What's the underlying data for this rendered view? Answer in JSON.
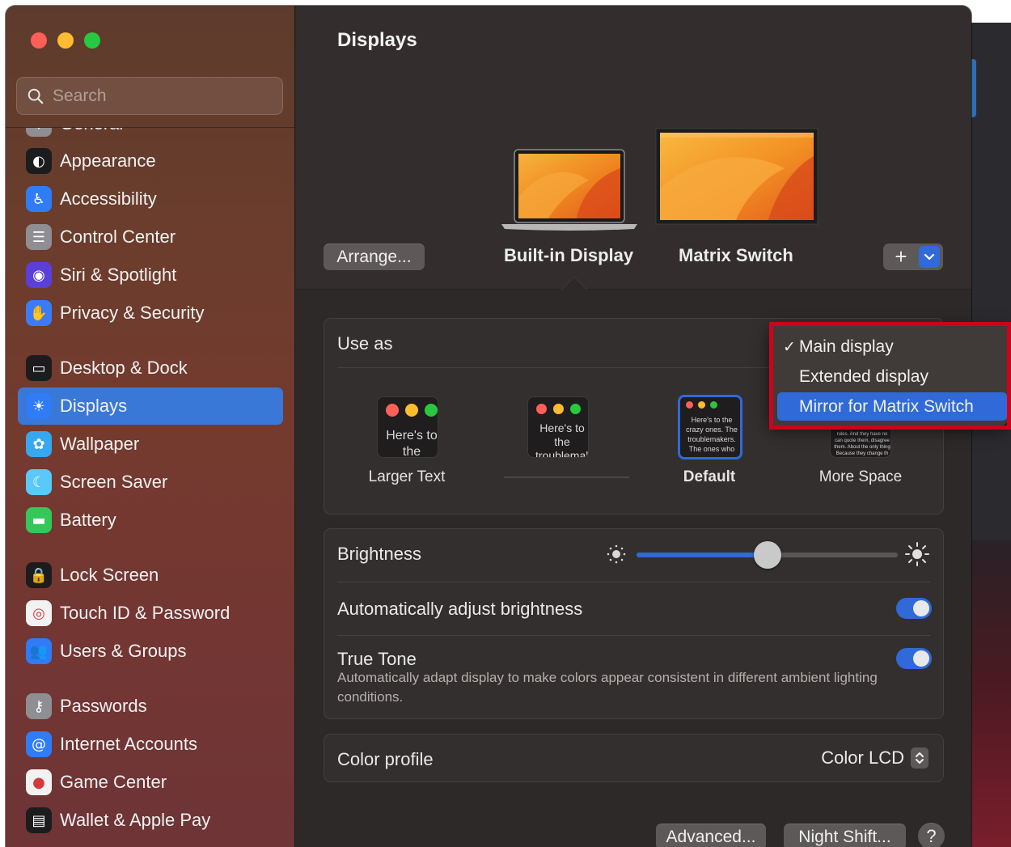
{
  "sidebar": {
    "search_placeholder": "Search",
    "items": [
      {
        "label": "General",
        "icon": "gear-icon",
        "color": "#8e8e93"
      },
      {
        "label": "Appearance",
        "icon": "appearance-icon",
        "color": "#1c1c1e"
      },
      {
        "label": "Accessibility",
        "icon": "accessibility-icon",
        "color": "#2f7cf6"
      },
      {
        "label": "Control Center",
        "icon": "control-center-icon",
        "color": "#8e8e93"
      },
      {
        "label": "Siri & Spotlight",
        "icon": "siri-icon",
        "color": "#5a3fd9"
      },
      {
        "label": "Privacy & Security",
        "icon": "hand-icon",
        "color": "#3a7cf6"
      },
      {
        "label": "Desktop & Dock",
        "icon": "dock-icon",
        "color": "#1c1c1e"
      },
      {
        "label": "Displays",
        "icon": "sun-icon",
        "color": "#2f7cf6"
      },
      {
        "label": "Wallpaper",
        "icon": "flower-icon",
        "color": "#37a7f0"
      },
      {
        "label": "Screen Saver",
        "icon": "screensaver-icon",
        "color": "#5ac8fa"
      },
      {
        "label": "Battery",
        "icon": "battery-icon",
        "color": "#34c759"
      },
      {
        "label": "Lock Screen",
        "icon": "lock-icon",
        "color": "#1c1c1e"
      },
      {
        "label": "Touch ID & Password",
        "icon": "fingerprint-icon",
        "color": "#f2f2f2"
      },
      {
        "label": "Users & Groups",
        "icon": "users-icon",
        "color": "#2f7cf6"
      },
      {
        "label": "Passwords",
        "icon": "key-icon",
        "color": "#8e8e93"
      },
      {
        "label": "Internet Accounts",
        "icon": "at-icon",
        "color": "#2f7cf6"
      },
      {
        "label": "Game Center",
        "icon": "game-center-icon",
        "color": "#f2f2f2"
      },
      {
        "label": "Wallet & Apple Pay",
        "icon": "wallet-icon",
        "color": "#1c1c1e"
      }
    ],
    "selected": "Displays"
  },
  "main": {
    "title": "Displays",
    "arrange_label": "Arrange...",
    "displays": [
      "Built-in Display",
      "Matrix Switch"
    ],
    "plus_label": "+",
    "use_as_label": "Use as",
    "use_as_menu": {
      "items": [
        "Main display",
        "Extended display",
        "Mirror for Matrix Switch"
      ],
      "checked": "Main display",
      "highlighted": "Mirror for Matrix Switch",
      "check_glyph": "✓"
    },
    "resolution_options": [
      {
        "label": "Larger Text",
        "preview_text": "Here's to the troublemakers"
      },
      {
        "label": "",
        "preview_text": "Here's to the troublemakers, ones who"
      },
      {
        "label": "Default",
        "preview_text": "Here's to the crazy ones. The troublemakers. The ones who see things rules. And they"
      },
      {
        "label": "More Space",
        "preview_text": "rules. And they have no can quote them, disagree them. About the only thing Because they change th"
      }
    ],
    "brightness_label": "Brightness",
    "brightness_level": 0.5,
    "auto_brightness_label": "Automatically adjust brightness",
    "auto_brightness_on": true,
    "true_tone_label": "True Tone",
    "true_tone_desc": "Automatically adapt display to make colors appear consistent in different ambient lighting conditions.",
    "true_tone_on": true,
    "color_profile_label": "Color profile",
    "color_profile_value": "Color LCD",
    "advanced_label": "Advanced...",
    "night_shift_label": "Night Shift...",
    "help_label": "?"
  },
  "colors": {
    "accent": "#2f6ad8",
    "annotation_red": "#d0021b"
  }
}
